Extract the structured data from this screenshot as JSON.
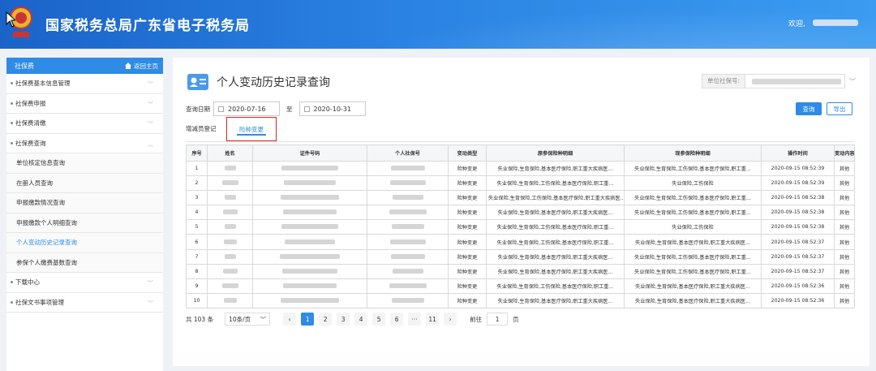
{
  "header": {
    "title": "国家税务总局广东省电子税务局",
    "welcome": "欢迎,"
  },
  "sidebar": {
    "title": "社保费",
    "home": "返回主页",
    "items": [
      {
        "label": "社保费基本信息管理",
        "type": "group"
      },
      {
        "label": "社保费申报",
        "type": "group"
      },
      {
        "label": "社保费清缴",
        "type": "group"
      },
      {
        "label": "社保费查询",
        "type": "group",
        "expanded": true
      },
      {
        "label": "单位核定信息查询",
        "type": "sub"
      },
      {
        "label": "在册人员查询",
        "type": "sub"
      },
      {
        "label": "申报缴款情况查询",
        "type": "sub"
      },
      {
        "label": "申报缴款个人明细查询",
        "type": "sub"
      },
      {
        "label": "个人变动历史记录查询",
        "type": "sub",
        "active": true
      },
      {
        "label": "参保个人缴费基数查询",
        "type": "sub"
      },
      {
        "label": "下载中心",
        "type": "group"
      },
      {
        "label": "社保文书事项管理",
        "type": "group"
      }
    ]
  },
  "page": {
    "title": "个人变动历史记录查询",
    "unit_label": "单位社保号:",
    "query_date_label": "查询日期",
    "date_from": "2020-07-16",
    "to_label": "至",
    "date_to": "2020-10-31",
    "query_button": "查询",
    "export_button": "导出",
    "tabs": [
      "增减员登记",
      "险种变更"
    ],
    "active_tab": "险种变更"
  },
  "table": {
    "columns": [
      "序号",
      "姓名",
      "证件号码",
      "个人社保号",
      "变动类型",
      "原参保险种明细",
      "现参保险种明细",
      "操作时间",
      "变动内容"
    ],
    "rows": [
      {
        "no": "1",
        "type": "险种变更",
        "orig": "失业保险,生育保险,基本医疗保险,职工重大疾病医...",
        "curr": "失业保险,生育保险,工伤保险,基本医疗保险,职工重...",
        "time": "2020-09-15 08:52:39",
        "content": "其他"
      },
      {
        "no": "2",
        "type": "险种变更",
        "orig": "失业保险,生育保险,工伤保险,基本医疗保险,职工重...",
        "curr": "失业保险,工伤保险",
        "time": "2020-09-15 08:52:39",
        "content": "其他"
      },
      {
        "no": "3",
        "type": "险种变更",
        "orig": "失业保险,生育保险,工伤保险,基本医疗保险,职工重大疾病医...",
        "curr": "失业保险,生育保险,工伤保险,基本医疗保险,职工重...",
        "time": "2020-09-15 08:52:38",
        "content": "其他"
      },
      {
        "no": "4",
        "type": "险种变更",
        "orig": "失业保险,生育保险,基本医疗保险,职工重大疾病医...",
        "curr": "失业保险,生育保险,工伤保险,基本医疗保险,职工重...",
        "time": "2020-09-15 08:52:38",
        "content": "其他"
      },
      {
        "no": "5",
        "type": "险种变更",
        "orig": "失业保险,生育保险,工伤保险,基本医疗保险,职工重...",
        "curr": "失业保险,工伤保险",
        "time": "2020-09-15 08:52:38",
        "content": "其他"
      },
      {
        "no": "6",
        "type": "险种变更",
        "orig": "失业保险,生育保险,工伤保险,基本医疗保险,职工重...",
        "curr": "失业保险,生育保险,基本医疗保险,职工重大疾病医...",
        "time": "2020-09-15 08:52:37",
        "content": "其他"
      },
      {
        "no": "7",
        "type": "险种变更",
        "orig": "失业保险,生育保险,基本医疗保险,职工重大疾病医...",
        "curr": "失业保险,生育保险,工伤保险,基本医疗保险,职工重...",
        "time": "2020-09-15 08:52:37",
        "content": "其他"
      },
      {
        "no": "8",
        "type": "险种变更",
        "orig": "失业保险,生育保险,基本医疗保险,职工重大疾病医...",
        "curr": "失业保险,生育保险,工伤保险,基本医疗保险,职工重...",
        "time": "2020-09-15 08:52:37",
        "content": "其他"
      },
      {
        "no": "9",
        "type": "险种变更",
        "orig": "失业保险,生育保险,工伤保险,基本医疗保险,职工重...",
        "curr": "失业保险,生育保险,基本医疗保险,职工重大疾病医...",
        "time": "2020-09-15 08:52:36",
        "content": "其他"
      },
      {
        "no": "10",
        "type": "险种变更",
        "orig": "失业保险,生育保险,基本医疗保险,职工重大疾病医...",
        "curr": "失业保险,生育保险,基本医疗保险,职工重大疾病医...",
        "time": "2020-09-15 08:52:36",
        "content": "其他"
      }
    ]
  },
  "pagination": {
    "total": "共 103 条",
    "page_size": "10条/页",
    "prev": "‹",
    "pages": [
      "1",
      "2",
      "3",
      "4",
      "5",
      "6",
      "···",
      "11"
    ],
    "current": "1",
    "next": "›",
    "goto_label": "前往",
    "goto_value": "1",
    "goto_suffix": "页"
  },
  "colors": {
    "header_blue": "#2a82e2",
    "accent": "#2e8be6",
    "highlight_border": "#e02424"
  }
}
